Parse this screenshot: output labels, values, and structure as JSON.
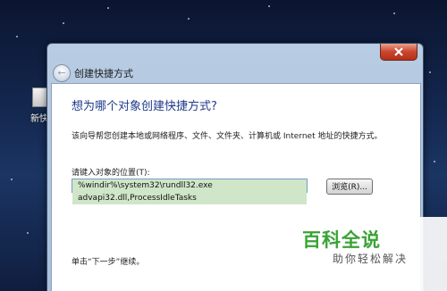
{
  "desktop": {
    "icon_label": "新快捷"
  },
  "window": {
    "title": "创建快捷方式",
    "back_glyph": "←"
  },
  "wizard": {
    "heading": "想为哪个对象创建快捷方式?",
    "description": "该向导帮您创建本地或网络程序、文件、文件夹、计算机或 Internet 地址的快捷方式。",
    "location_label": "请键入对象的位置(T):",
    "location_value": "%windir%\\system32\\rundll32.exe advapi32.dll,ProcessIdleTasks",
    "browse_label": "浏览(R)...",
    "hint": "单击“下一步”继续。"
  },
  "watermark": {
    "main": "百科全说",
    "sub": "助你轻松解决"
  },
  "colors": {
    "heading": "#1f3a8a",
    "selection": "#cfe6c8",
    "close_button": "#c9452c",
    "watermark_green": "#3aa335"
  }
}
